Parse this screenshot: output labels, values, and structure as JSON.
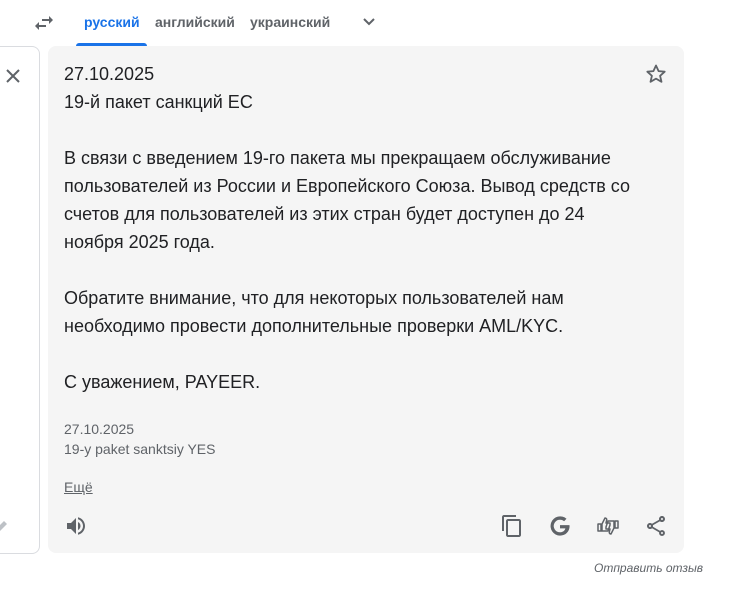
{
  "tabs": [
    {
      "label": "русский",
      "active": true
    },
    {
      "label": "английский",
      "active": false
    },
    {
      "label": "украинский",
      "active": false
    }
  ],
  "translation": {
    "lines": [
      "27.10.2025",
      "19-й пакет санкций ЕС",
      "",
      "В связи с введением 19-го пакета мы прекращаем обслуживание пользователей из России и Европейского Союза. Вывод средств со счетов для пользователей из этих стран будет доступен до 24 ноября 2025 года.",
      "",
      "Обратите внимание, что для некоторых пользователей нам необходимо провести дополнительные проверки AML/KYC.",
      "",
      "С уважением, PAYEER."
    ]
  },
  "transliteration": {
    "lines": [
      "27.10.2025",
      "19-y paket sanktsiy YES"
    ]
  },
  "more_label": "Ещё",
  "feedback_label": "Отправить отзыв",
  "icons": {
    "swap": "swap-languages-icon",
    "chevron": "chevron-down-icon",
    "close": "close-icon",
    "star": "star-icon",
    "speaker": "speaker-icon",
    "copy": "copy-icon",
    "google": "google-icon",
    "rate": "rate-translation-icon",
    "share": "share-icon"
  },
  "colors": {
    "accent": "#1a73e8",
    "card_bg": "#f5f5f5",
    "text": "#202124",
    "muted": "#5f6368"
  }
}
